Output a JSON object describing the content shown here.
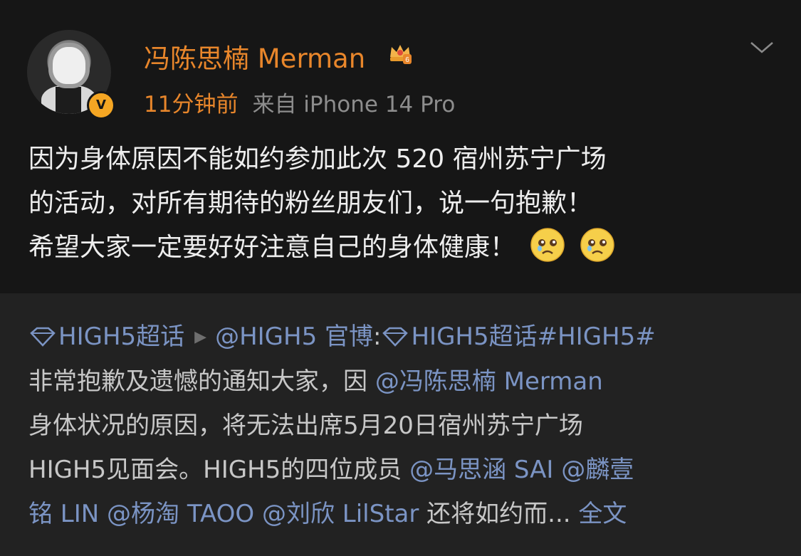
{
  "post": {
    "author_name": "冯陈思楠 Merman",
    "timestamp": "11分钟前",
    "source": "来自 iPhone 14 Pro",
    "verified_badge": "V",
    "content_lines": [
      "因为身体原因不能如约参加此次 520 宿州苏宁广场",
      "的活动，对所有期待的粉丝朋友们，说一句抱歉！",
      "希望大家一定要好好注意自己的身体健康！"
    ],
    "emoji": [
      "crying-face-icon",
      "crying-face-icon"
    ]
  },
  "repost": {
    "l1_topic": "HIGH5超话",
    "l1_author": "@HIGH5 官博",
    "l1_colon": ":",
    "l1_topic2": "HIGH5超话",
    "l1_hashtag": "#HIGH5#",
    "l2_text": "非常抱歉及遗憾的通知大家，因 ",
    "l2_mention": "@冯陈思楠 Merman",
    "l3_text": "身体状况的原因，将无法出席5月20日宿州苏宁广场",
    "l4_text": "HIGH5见面会。HIGH5的四位成员 ",
    "l4_mention1": "@马思涵 SAI",
    "l4_mention2": "@麟壹",
    "l5_mention2_cont": "铭 LIN",
    "l5_mention3": "@杨淘 TAOO",
    "l5_mention4": "@刘欣 LilStar",
    "l5_text": " 还将如约而...",
    "l5_more": "全文"
  },
  "colors": {
    "accent_orange": "#e8862b",
    "link_blue": "#7b94c4",
    "background": "#161616",
    "repost_background": "#222222"
  },
  "icons": {
    "crown": "vip-crown-icon",
    "verify": "verified-badge-icon",
    "menu": "chevron-down-icon",
    "topic": "super-topic-gem-icon"
  }
}
